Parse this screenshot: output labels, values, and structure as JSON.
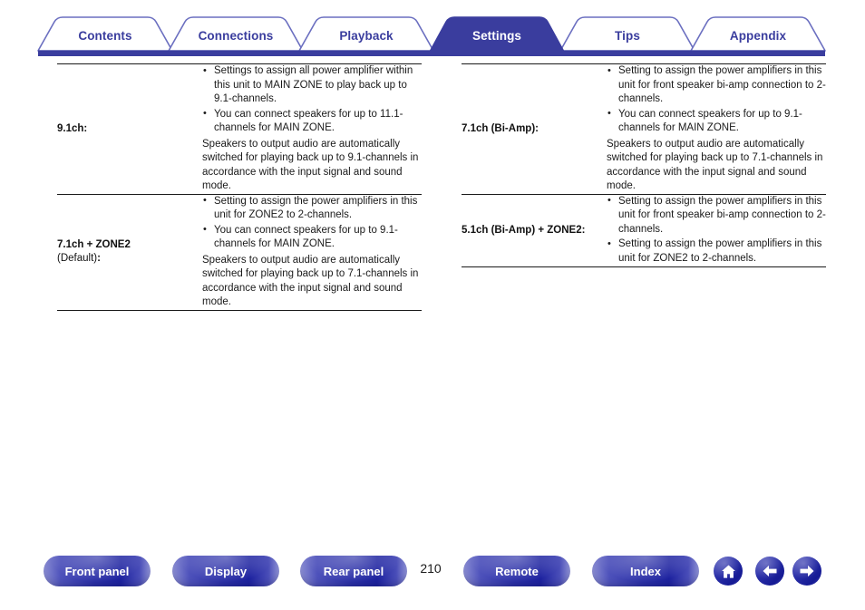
{
  "tabs": [
    {
      "label": "Contents",
      "active": false
    },
    {
      "label": "Connections",
      "active": false
    },
    {
      "label": "Playback",
      "active": false
    },
    {
      "label": "Settings",
      "active": true
    },
    {
      "label": "Tips",
      "active": false
    },
    {
      "label": "Appendix",
      "active": false
    }
  ],
  "colors": {
    "brand_blue": "#3a3d9e",
    "tab_active_fill": "#3a3d9e",
    "tab_outline": "#6b6fc0",
    "rule": "#1a1a1a",
    "body_text": "#1a1a1a"
  },
  "left_table": {
    "rows": [
      {
        "key": "9.1ch:",
        "key_sub": "",
        "bullets": [
          "Settings to assign all power amplifier within this unit to MAIN ZONE to play back up to 9.1-channels.",
          "You can connect speakers for up to 11.1-channels for MAIN ZONE."
        ],
        "note": "Speakers to output audio are automatically switched for playing back up to 9.1-channels in accordance with the input signal and sound mode."
      },
      {
        "key": "7.1ch + ZONE2",
        "key_sub": "(Default)",
        "bullets": [
          "Setting to assign the power amplifiers in this unit for ZONE2 to 2-channels.",
          "You can connect speakers for up to 9.1-channels for MAIN ZONE."
        ],
        "note": "Speakers to output audio are automatically switched for playing back up to 7.1-channels in accordance with the input signal and sound mode."
      }
    ]
  },
  "right_table": {
    "rows": [
      {
        "key": "7.1ch (Bi-Amp):",
        "key_sub": "",
        "bullets": [
          "Setting to assign the power amplifiers in this unit for front speaker bi-amp connection to 2-channels.",
          "You can connect speakers for up to 9.1-channels for MAIN ZONE."
        ],
        "note": "Speakers to output audio are automatically switched for playing back up to 7.1-channels in accordance with the input signal and sound mode."
      },
      {
        "key": "5.1ch (Bi-Amp) + ZONE2:",
        "key_sub": "",
        "bullets": [
          "Setting to assign the power amplifiers in this unit for front speaker bi-amp connection to 2-channels.",
          "Setting to assign the power amplifiers in this unit for ZONE2 to 2-channels."
        ],
        "note": ""
      }
    ]
  },
  "footer": {
    "buttons": [
      {
        "label": "Front panel"
      },
      {
        "label": "Display"
      },
      {
        "label": "Rear panel"
      },
      {
        "label": "Remote"
      },
      {
        "label": "Index"
      }
    ],
    "page_number": "210",
    "icons": [
      {
        "name": "home-icon"
      },
      {
        "name": "arrow-left-icon"
      },
      {
        "name": "arrow-right-icon"
      }
    ]
  }
}
